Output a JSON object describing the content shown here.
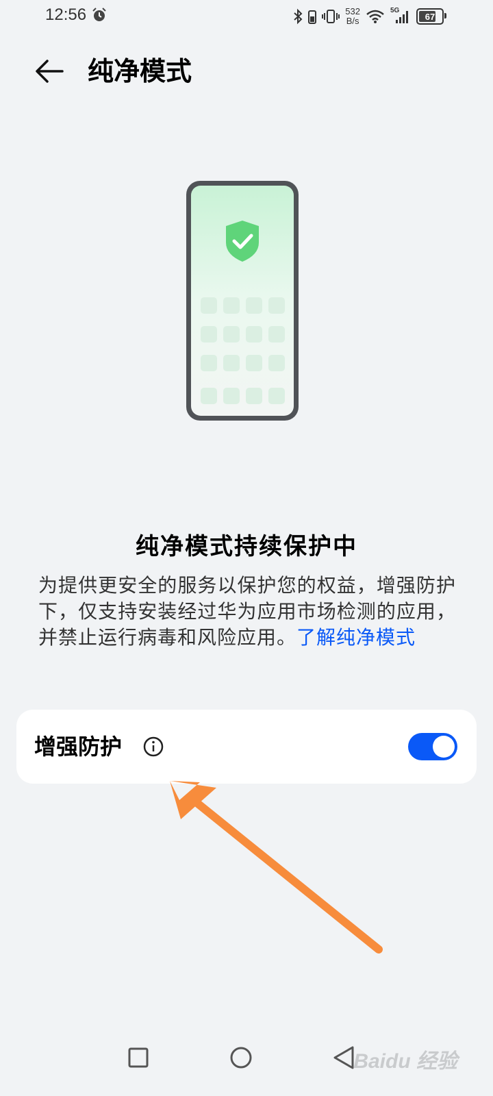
{
  "status_bar": {
    "time": "12:56",
    "net_speed_value": "532",
    "net_speed_unit": "B/s",
    "network_type": "5G",
    "battery": "67",
    "icons": [
      "alarm-icon",
      "bluetooth-icon",
      "vibrate-icon",
      "wifi-icon",
      "signal-icon",
      "battery-icon"
    ]
  },
  "header": {
    "title": "纯净模式",
    "back_icon": "arrow-left-icon"
  },
  "illustration": {
    "icon": "shield-check-icon",
    "accent_color": "#5fd47a"
  },
  "main": {
    "headline": "纯净模式持续保护中",
    "description": "为提供更安全的服务以保护您的权益，增强防护下，仅支持安装经过华为应用市场检测的应用，并禁止运行病毒和风险应用。",
    "learn_more_link": "了解纯净模式"
  },
  "setting": {
    "label": "增强防护",
    "info_icon": "info-icon",
    "toggle_on": true,
    "toggle_color": "#0a59f7"
  },
  "annotation": {
    "arrow_color": "#f78c3c"
  },
  "nav_bar": {
    "recent_icon": "square-icon",
    "home_icon": "circle-icon",
    "back_icon": "triangle-back-icon"
  },
  "watermark": {
    "text": "Baidu 经验"
  }
}
